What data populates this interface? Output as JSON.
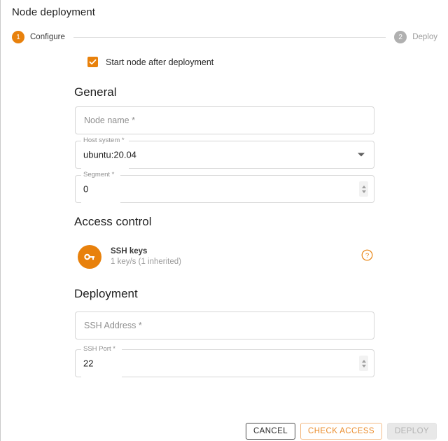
{
  "window": {
    "title": "Node deployment"
  },
  "stepper": {
    "steps": [
      {
        "number": "1",
        "label": "Configure",
        "state": "active"
      },
      {
        "number": "2",
        "label": "Deploy",
        "state": "inactive"
      }
    ]
  },
  "start_after_deploy": {
    "label": "Start node after deployment",
    "checked": true
  },
  "sections": {
    "general": {
      "heading": "General",
      "node_name": {
        "placeholder": "Node name *",
        "value": ""
      },
      "host_system": {
        "label": "Host system *",
        "value": "ubuntu:20.04"
      },
      "segment": {
        "label": "Segment *",
        "value": "0"
      }
    },
    "access_control": {
      "heading": "Access control",
      "ssh_keys": {
        "title": "SSH keys",
        "subtitle": "1 key/s (1 inherited)"
      }
    },
    "deployment": {
      "heading": "Deployment",
      "ssh_address": {
        "placeholder": "SSH Address *",
        "value": ""
      },
      "ssh_port": {
        "label": "SSH Port *",
        "value": "22"
      }
    }
  },
  "footer": {
    "cancel_label": "CANCEL",
    "check_access_label": "CHECK ACCESS",
    "deploy_label": "DEPLOY"
  },
  "colors": {
    "accent": "#e8810c",
    "accent_light": "#f3bb86",
    "disabled": "#b0b0b0",
    "border": "#d6d6d6"
  }
}
